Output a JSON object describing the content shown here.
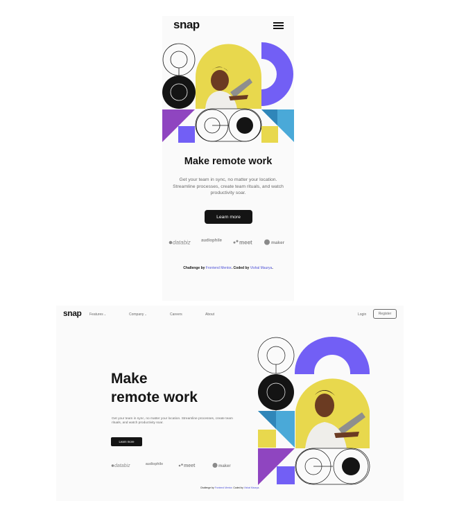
{
  "mobile": {
    "logo": "snap",
    "menu_icon": "hamburger-menu-icon",
    "hero_title": "Make remote work",
    "hero_subtitle": "Get your team in sync, no matter your location. Streamline processes, create team rituals, and watch productivity soar.",
    "cta_label": "Learn more",
    "clients": [
      "databiz",
      "audiophile",
      "meet",
      "maker"
    ],
    "footer": {
      "challenge_prefix": "Challenge by ",
      "challenge_link": "Frontend Mentor",
      "coded_prefix": ". Coded by ",
      "coded_link": "Vishal Maurya",
      "suffix": "."
    }
  },
  "desktop": {
    "logo": "snap",
    "nav": [
      {
        "label": "Features",
        "has_dropdown": true
      },
      {
        "label": "Company",
        "has_dropdown": true
      },
      {
        "label": "Careers",
        "has_dropdown": false
      },
      {
        "label": "About",
        "has_dropdown": false
      }
    ],
    "login_label": "Login",
    "register_label": "Register",
    "hero_title_line1": "Make",
    "hero_title_line2": "remote work",
    "hero_subtitle": "Get your team in sync, no matter your location. Streamline processes, create team rituals, and watch productivity soar.",
    "cta_label": "Learn more",
    "clients": [
      "databiz",
      "audiophile",
      "meet",
      "maker"
    ],
    "footer": {
      "challenge_prefix": "Challenge by ",
      "challenge_link": "Frontend Mentor",
      "coded_prefix": ". Coded by ",
      "coded_link": "Vishal Maurya",
      "suffix": "."
    }
  },
  "colors": {
    "background": "#fafafa",
    "text_dark": "#141414",
    "text_gray": "#696969",
    "accent_purple": "#725ff5",
    "accent_yellow": "#e8d84d",
    "accent_blue": "#4aa9d8",
    "accent_violet": "#8f45c0",
    "link": "#4f52d6"
  }
}
